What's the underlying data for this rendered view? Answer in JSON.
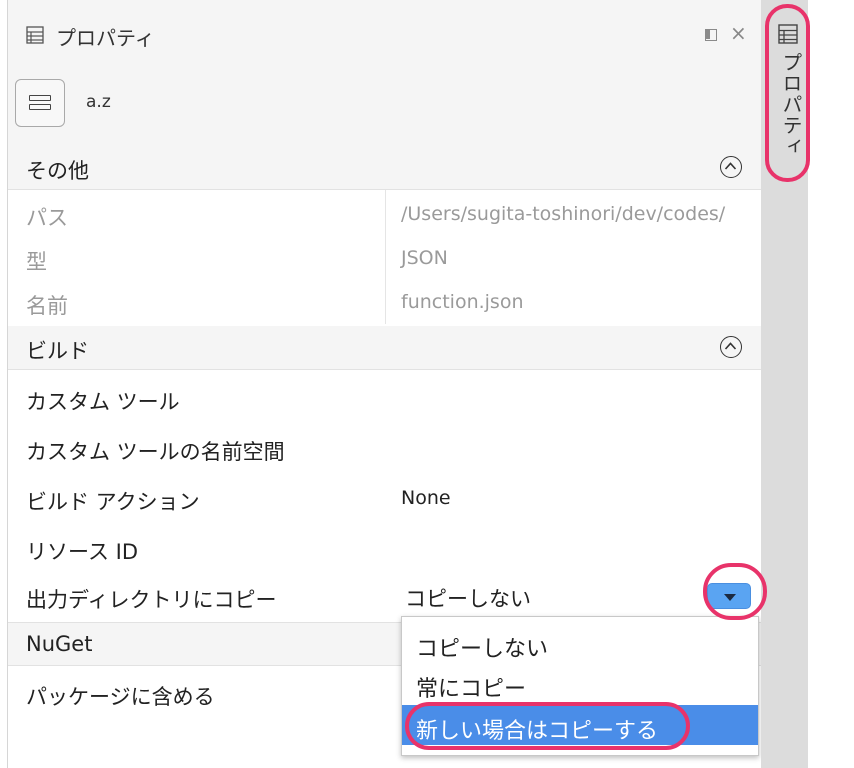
{
  "panel": {
    "title": "プロパティ",
    "file_name": "a.z"
  },
  "sections": {
    "other": {
      "label": "その他",
      "rows": [
        {
          "key": "パス",
          "value": "/Users/sugita-toshinori/dev/codes/"
        },
        {
          "key": "型",
          "value": "JSON"
        },
        {
          "key": "名前",
          "value": "function.json"
        }
      ]
    },
    "build": {
      "label": "ビルド",
      "rows": [
        {
          "key": "カスタム ツール",
          "value": ""
        },
        {
          "key": "カスタム ツールの名前空間",
          "value": ""
        },
        {
          "key": "ビルド アクション",
          "value": "None"
        },
        {
          "key": "リソース ID",
          "value": ""
        },
        {
          "key": "出力ディレクトリにコピー",
          "value": "コピーしない"
        }
      ]
    },
    "nuget": {
      "label": "NuGet",
      "rows": [
        {
          "key": "パッケージに含める",
          "value": ""
        }
      ]
    }
  },
  "dropdown": {
    "options": [
      "コピーしない",
      "常にコピー",
      "新しい場合はコピーする"
    ],
    "selected_index": 2
  },
  "sidebar": {
    "tab_label": "プロパティ"
  },
  "colors": {
    "highlight": "#e8336a",
    "selection": "#4a8de8",
    "dropdown_button": "#5aa4f2"
  }
}
